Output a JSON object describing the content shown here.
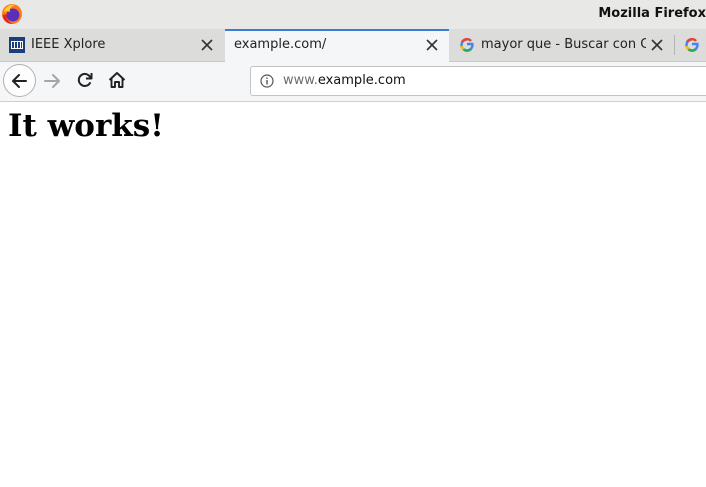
{
  "window": {
    "title": "Mozilla Firefox"
  },
  "tabs": [
    {
      "label": "IEEE Xplore",
      "favicon": "ieee-icon",
      "active": false
    },
    {
      "label": "example.com/",
      "favicon": "",
      "active": true
    },
    {
      "label": "mayor que - Buscar con Google",
      "favicon": "google-icon",
      "active": false
    },
    {
      "label": "",
      "favicon": "google-icon",
      "active": false
    }
  ],
  "toolbar": {
    "back_icon": "arrow-left-icon",
    "forward_icon": "arrow-right-icon",
    "reload_icon": "reload-icon",
    "home_icon": "home-icon"
  },
  "urlbar": {
    "info_icon": "info-icon",
    "url_prefix": "www.",
    "url_domain": "example.com"
  },
  "page": {
    "heading": "It works!"
  },
  "colors": {
    "active_tab_accent": "#3b7bd6"
  }
}
